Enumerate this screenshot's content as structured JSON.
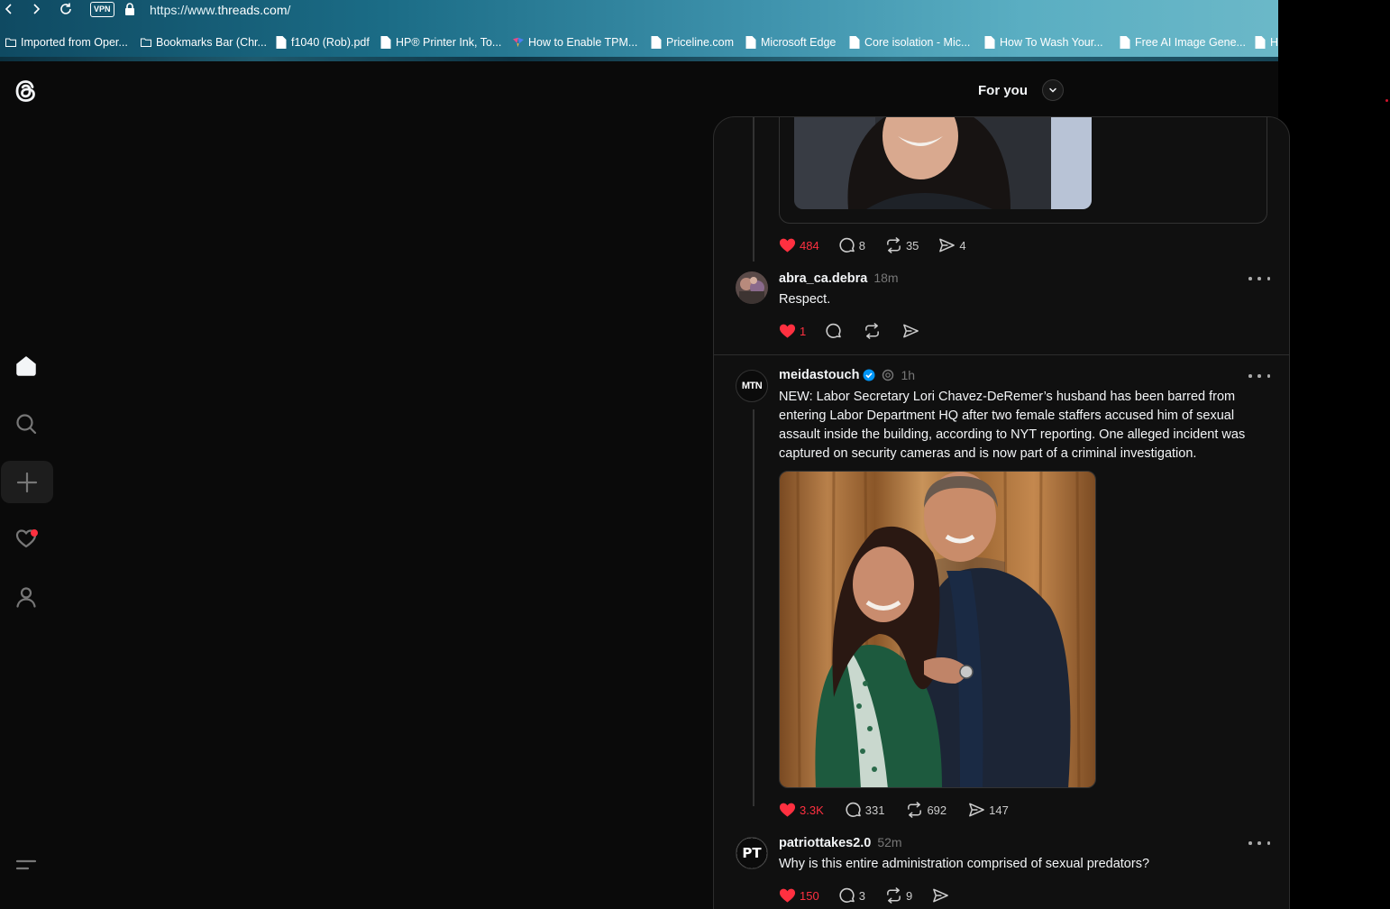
{
  "browser": {
    "vpn_label": "VPN",
    "url_prefix": "https://www.",
    "url_domain": "threads.com",
    "url_suffix": "/",
    "bookmarks": [
      {
        "label": "Imported from Oper...",
        "icon": "folder-icon"
      },
      {
        "label": "Bookmarks Bar (Chr...",
        "icon": "folder-icon"
      },
      {
        "label": "f1040 (Rob).pdf",
        "icon": "page-icon"
      },
      {
        "label": "HP® Printer Ink, To...",
        "icon": "page-icon"
      },
      {
        "label": "How to Enable TPM...",
        "icon": "colorful-favicon-icon"
      },
      {
        "label": "Priceline.com",
        "icon": "page-icon"
      },
      {
        "label": "Microsoft Edge",
        "icon": "page-icon"
      },
      {
        "label": "Core isolation - Mic...",
        "icon": "page-icon"
      },
      {
        "label": "How To Wash Your...",
        "icon": "page-icon"
      },
      {
        "label": "Free AI Image Gene...",
        "icon": "page-icon"
      },
      {
        "label": "H",
        "icon": "page-icon"
      }
    ]
  },
  "header": {
    "feed_title": "For you"
  },
  "sidebar": {
    "items": [
      "home-icon",
      "search-icon",
      "create-icon",
      "activity-icon",
      "profile-icon",
      "menu-icon"
    ]
  },
  "feed": {
    "first_post_stats": {
      "likes": "484",
      "replies": "8",
      "reposts": "35",
      "shares": "4"
    },
    "reply1": {
      "username": "abra_ca.debra",
      "time": "18m",
      "text": "Respect.",
      "likes": "1"
    },
    "post2": {
      "username": "meidastouch",
      "avatar_text": "MTN",
      "time": "1h",
      "text": "NEW: Labor Secretary Lori Chavez-DeRemer’s husband has been barred from entering Labor Department HQ after two female staffers accused him of sexual assault inside the building, according to NYT reporting. One alleged incident was captured on security cameras and is now part of a criminal investigation.",
      "likes": "3.3K",
      "replies": "331",
      "reposts": "692",
      "shares": "147"
    },
    "reply2": {
      "username": "patriottakes2.0",
      "avatar_text": "PT",
      "time": "52m",
      "text": "Why is this entire administration comprised of sexual predators?",
      "likes": "150",
      "replies": "3",
      "reposts": "9"
    }
  },
  "colors": {
    "like_red": "#ff3040",
    "verified_blue": "#0095f6",
    "background": "#101010"
  }
}
